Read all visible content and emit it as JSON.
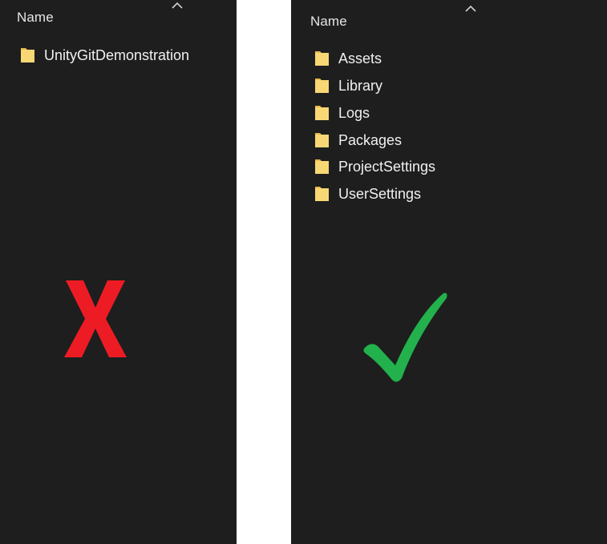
{
  "left_panel": {
    "column_header": "Name",
    "items": [
      {
        "label": "UnityGitDemonstration"
      }
    ],
    "verdict_icon": "x-mark-icon",
    "verdict_color": "#ed1c24"
  },
  "right_panel": {
    "column_header": "Name",
    "items": [
      {
        "label": "Assets"
      },
      {
        "label": "Library"
      },
      {
        "label": "Logs"
      },
      {
        "label": "Packages"
      },
      {
        "label": "ProjectSettings"
      },
      {
        "label": "UserSettings"
      }
    ],
    "verdict_icon": "check-mark-icon",
    "verdict_color": "#22b14c"
  },
  "colors": {
    "pane_background": "#1e1e1e",
    "gap_background": "#ffffff",
    "folder_yellow": "#f8d775"
  }
}
